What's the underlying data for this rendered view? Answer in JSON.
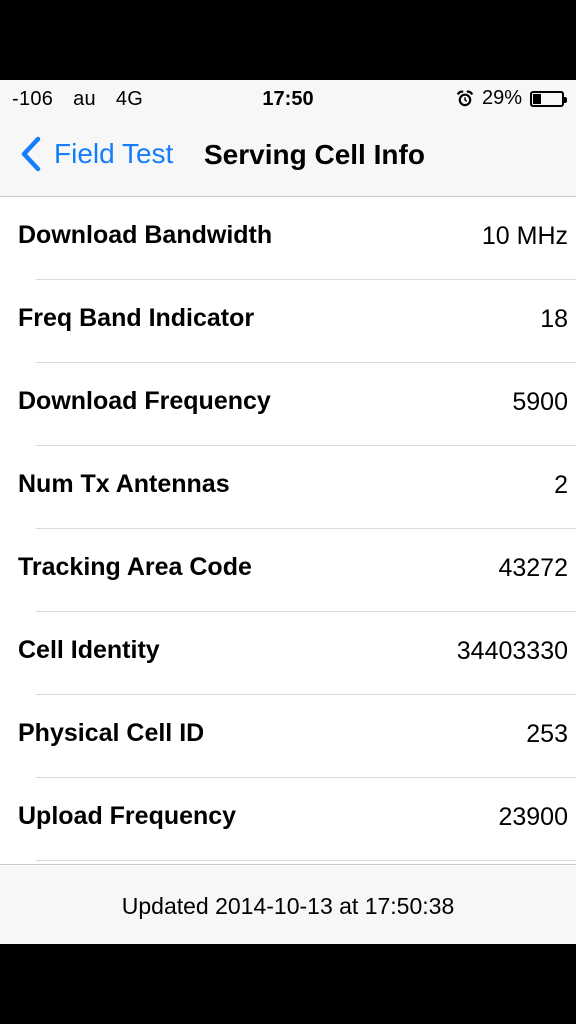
{
  "status_bar": {
    "signal": "-106",
    "carrier": "au",
    "network": "4G",
    "time": "17:50",
    "battery_percent": "29%",
    "battery_level": 0.29,
    "icons": [
      "alarm-icon",
      "battery-icon"
    ]
  },
  "nav": {
    "back_label": "Field Test",
    "title": "Serving Cell Info",
    "accent_color": "#157efb"
  },
  "rows": [
    {
      "label": "Download Bandwidth",
      "value": "10 MHz"
    },
    {
      "label": "Freq Band Indicator",
      "value": "18"
    },
    {
      "label": "Download Frequency",
      "value": "5900"
    },
    {
      "label": "Num Tx Antennas",
      "value": "2"
    },
    {
      "label": "Tracking Area Code",
      "value": "43272"
    },
    {
      "label": "Cell Identity",
      "value": "34403330"
    },
    {
      "label": "Physical Cell ID",
      "value": "253"
    },
    {
      "label": "Upload Frequency",
      "value": "23900"
    }
  ],
  "footer": {
    "updated_text": "Updated 2014-10-13 at 17:50:38"
  }
}
